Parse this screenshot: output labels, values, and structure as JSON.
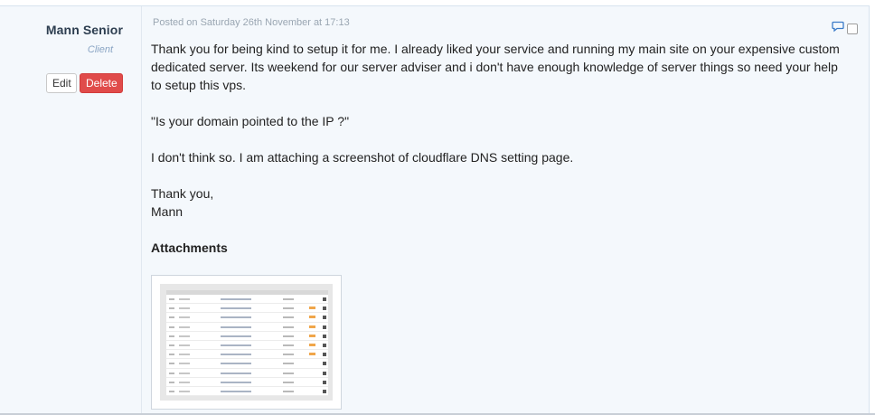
{
  "author": {
    "name": "Mann Senior",
    "role": "Client"
  },
  "actions": {
    "edit_label": "Edit",
    "delete_label": "Delete"
  },
  "post": {
    "posted": "Posted on Saturday 26th November at 17:13",
    "paragraphs": [
      "Thank you for being kind to setup it for me. I already liked your service and running my main site on your expensive custom dedicated server. Its weekend for our server adviser and i don't have enough knowledge of server things so need your help to setup this vps.",
      "\"Is your domain pointed to the IP ?\"",
      "I don't think so. I am attaching a screenshot of cloudflare DNS setting page."
    ],
    "signoff_line1": "Thank you,",
    "signoff_line2": "Mann",
    "attachments_title": "Attachments"
  },
  "icons": {
    "reply": "chat-bubble-icon",
    "select": "checkbox"
  },
  "colors": {
    "delete_button": "#e04b4a",
    "background": "#f4f8fc",
    "author_text": "#2d3e50",
    "role_text": "#8aa5c4",
    "posted_text": "#9aa6b2"
  }
}
